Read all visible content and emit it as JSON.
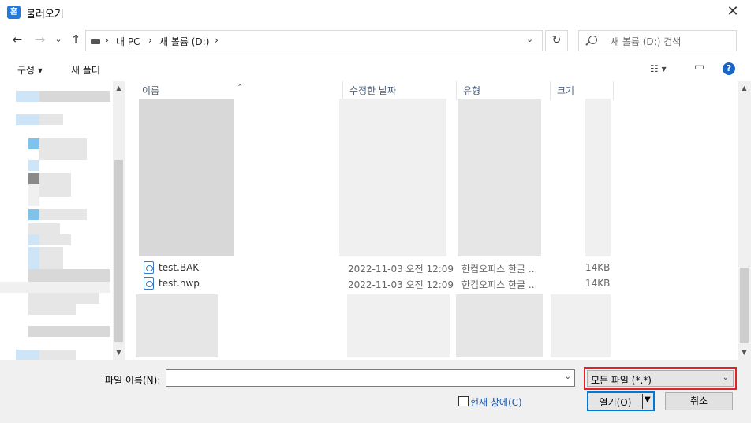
{
  "window": {
    "title": "불러오기",
    "app_icon_glyph": "흔",
    "close_glyph": "✕"
  },
  "nav": {
    "back_glyph": "←",
    "forward_glyph": "→",
    "recent_glyph": "⌄",
    "up_glyph": "↑",
    "path": [
      "내 PC",
      "새 볼륨 (D:)"
    ],
    "separator": "›",
    "refresh_glyph": "↻",
    "search_placeholder": "새 볼륨 (D:) 검색"
  },
  "toolbar": {
    "organize": "구성 ▾",
    "new_folder": "새 폴더",
    "view_glyph": "☷ ▾",
    "pane_glyph": "▭",
    "help_glyph": "?"
  },
  "columns": {
    "name": "이름",
    "date": "수정한 날짜",
    "type": "유형",
    "size": "크기"
  },
  "files": [
    {
      "name": "test.BAK",
      "date": "2022-11-03 오전 12:09",
      "type": "한컴오피스 한글 ...",
      "size": "14KB"
    },
    {
      "name": "test.hwp",
      "date": "2022-11-03 오전 12:09",
      "type": "한컴오피스 한글 ...",
      "size": "14KB"
    }
  ],
  "bottom": {
    "filename_label": "파일 이름(N):",
    "filename_value": "",
    "filter_value": "모든 파일 (*.*)",
    "current_window_label": "현재 창에(C)",
    "open_label": "열기(O)",
    "cancel_label": "취소"
  },
  "colors": {
    "accent": "#0078d7",
    "highlight_border": "#e0202a"
  }
}
